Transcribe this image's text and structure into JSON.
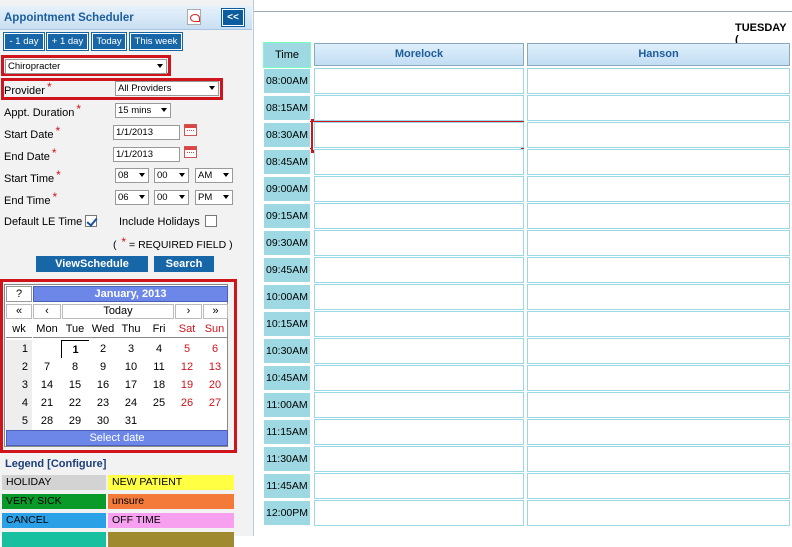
{
  "sidebar": {
    "title": "Appointment Scheduler",
    "collapse_label": "<<",
    "nav_buttons": [
      "- 1 day",
      "+ 1 day",
      "Today",
      "This week"
    ],
    "clinic_select": "Chiropracter",
    "provider_label": "Provider",
    "provider_select": "All Providers",
    "duration_label": "Appt. Duration",
    "duration_select": "15 mins",
    "start_date_label": "Start Date",
    "start_date_value": "1/1/2013",
    "end_date_label": "End Date",
    "end_date_value": "1/1/2013",
    "start_time_label": "Start Time",
    "start_hour": "08",
    "start_min": "00",
    "start_ampm": "AM",
    "end_time_label": "End Time",
    "end_hour": "06",
    "end_min": "00",
    "end_ampm": "PM",
    "default_le_label": "Default LE Time",
    "include_holidays_label": "Include Holidays",
    "required_note_open": "(",
    "required_note_star": "*",
    "required_note_text": "= REQUIRED FIELD )",
    "view_button": "ViewSchedule",
    "search_button": "Search"
  },
  "calendar": {
    "help": "?",
    "month": "January, 2013",
    "prev_year": "«",
    "prev_month": "‹",
    "today": "Today",
    "next_month": "›",
    "next_year": "»",
    "headers": [
      "wk",
      "Mon",
      "Tue",
      "Wed",
      "Thu",
      "Fri",
      "Sat",
      "Sun"
    ],
    "weeks": [
      {
        "wk": "1",
        "days": [
          "",
          "1",
          "2",
          "3",
          "4",
          "5",
          "6"
        ]
      },
      {
        "wk": "2",
        "days": [
          "7",
          "8",
          "9",
          "10",
          "11",
          "12",
          "13"
        ]
      },
      {
        "wk": "3",
        "days": [
          "14",
          "15",
          "16",
          "17",
          "18",
          "19",
          "20"
        ]
      },
      {
        "wk": "4",
        "days": [
          "21",
          "22",
          "23",
          "24",
          "25",
          "26",
          "27"
        ]
      },
      {
        "wk": "5",
        "days": [
          "28",
          "29",
          "30",
          "31",
          "",
          "",
          ""
        ]
      }
    ],
    "select_label": "Select date"
  },
  "legend": {
    "title": "Legend [Configure]",
    "items": [
      {
        "label": "HOLIDAY",
        "color": "#d3d3d3"
      },
      {
        "label": "NEW PATIENT",
        "color": "#ffff44"
      },
      {
        "label": "VERY SICK",
        "color": "#0a9a2a"
      },
      {
        "label": "unsure",
        "color": "#f47a3a"
      },
      {
        "label": "CANCEL",
        "color": "#2aa0e6"
      },
      {
        "label": "OFF TIME",
        "color": "#f7a0f0"
      }
    ]
  },
  "schedule": {
    "day_label": "TUESDAY (",
    "time_header": "Time",
    "providers": [
      "Morelock",
      "Hanson"
    ],
    "times": [
      "08:00AM",
      "08:15AM",
      "08:30AM",
      "08:45AM",
      "09:00AM",
      "09:15AM",
      "09:30AM",
      "09:45AM",
      "10:00AM",
      "10:15AM",
      "10:30AM",
      "10:45AM",
      "11:00AM",
      "11:15AM",
      "11:30AM",
      "11:45AM",
      "12:00PM"
    ]
  }
}
